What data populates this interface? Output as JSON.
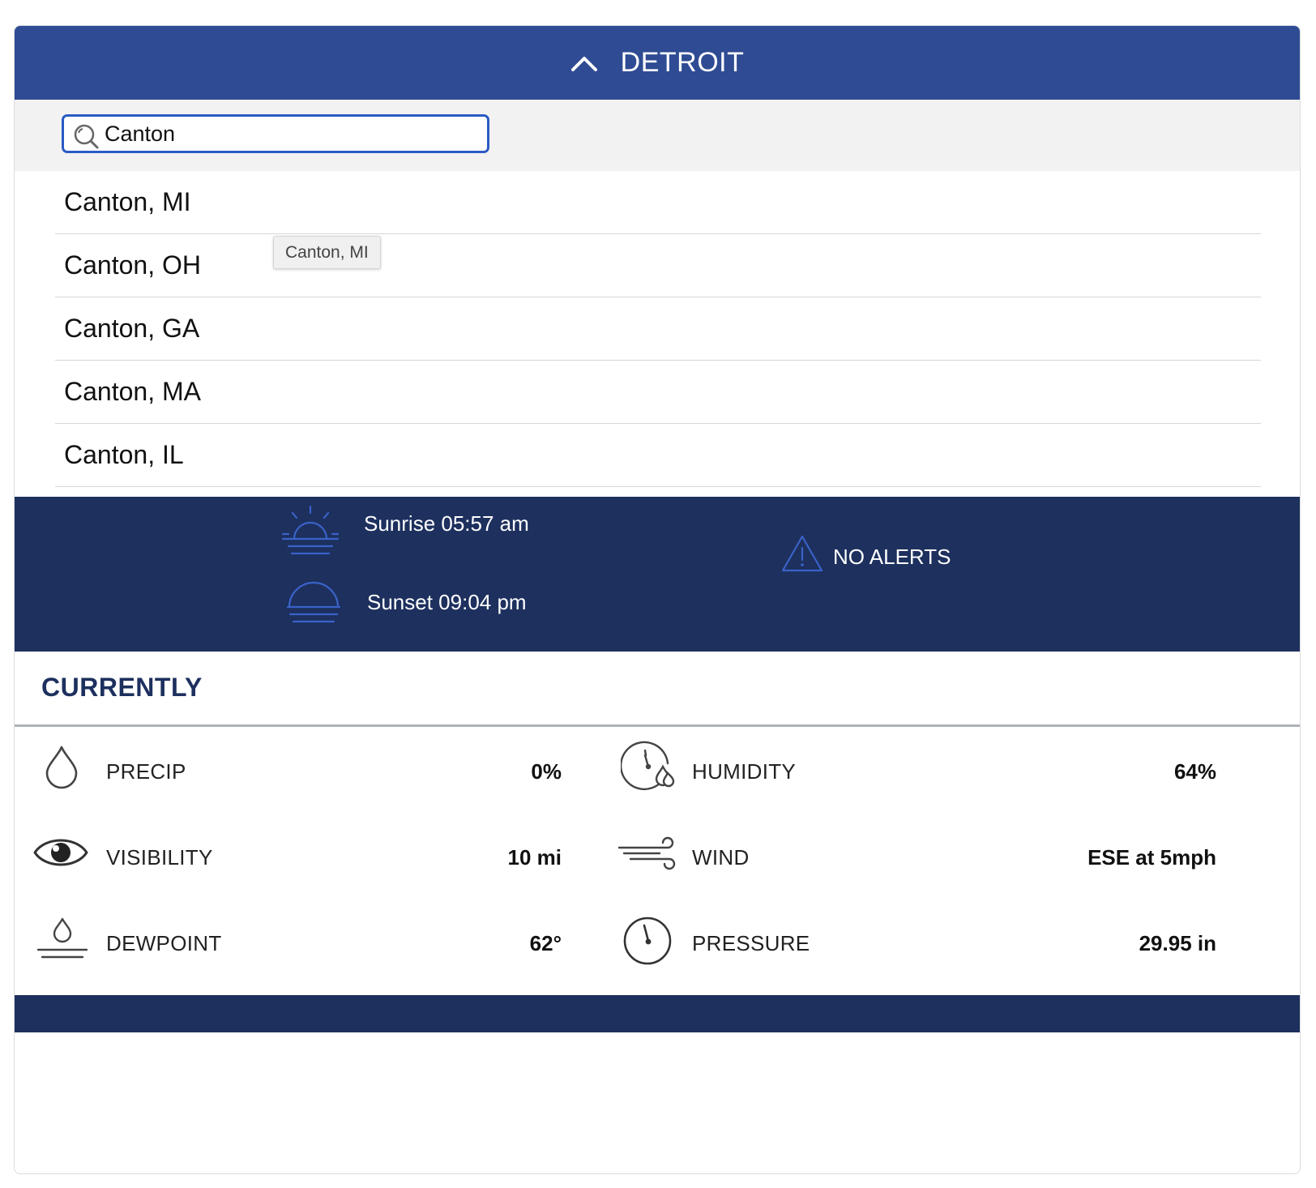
{
  "header": {
    "title": "DETROIT",
    "toggle_icon": "chevron-up-icon"
  },
  "search": {
    "value": "Canton",
    "icon": "search-icon"
  },
  "results": [
    {
      "label": "Canton, MI"
    },
    {
      "label": "Canton, OH"
    },
    {
      "label": "Canton, GA"
    },
    {
      "label": "Canton, MA"
    },
    {
      "label": "Canton, IL"
    }
  ],
  "tooltip": {
    "text": "Canton, MI"
  },
  "sun": {
    "sunrise": "Sunrise 05:57 am",
    "sunset": "Sunset 09:04 pm",
    "alerts": "NO ALERTS"
  },
  "currently": {
    "title": "CURRENTLY",
    "precip": {
      "label": "PRECIP",
      "value": "0%",
      "icon": "droplet-icon"
    },
    "humidity": {
      "label": "HUMIDITY",
      "value": "64%",
      "icon": "humidity-gauge-icon"
    },
    "visibility": {
      "label": "VISIBILITY",
      "value": "10 mi",
      "icon": "eye-icon"
    },
    "wind": {
      "label": "WIND",
      "value": "ESE at 5mph",
      "icon": "wind-icon"
    },
    "dewpoint": {
      "label": "DEWPOINT",
      "value": "62°",
      "icon": "dewpoint-icon"
    },
    "pressure": {
      "label": "PRESSURE",
      "value": "29.95 in",
      "icon": "pressure-gauge-icon"
    }
  },
  "colors": {
    "header_bg": "#2e4b93",
    "band_bg": "#1d305e",
    "accent_icon": "#3a62c8",
    "search_border": "#2a5bc4"
  }
}
